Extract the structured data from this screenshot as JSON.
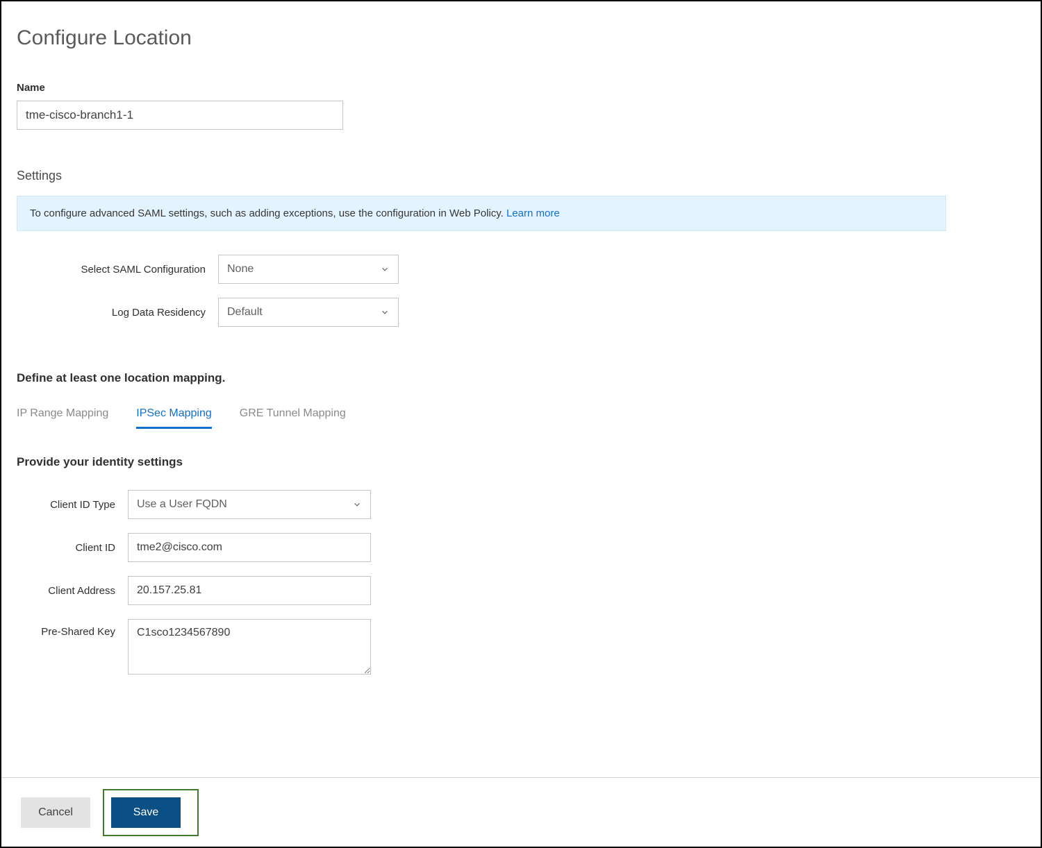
{
  "page": {
    "title": "Configure Location"
  },
  "name": {
    "label": "Name",
    "value": "tme-cisco-branch1-1"
  },
  "settings": {
    "heading": "Settings",
    "banner_text": "To configure advanced SAML settings, such as adding exceptions, use the configuration in Web Policy. ",
    "banner_link": "Learn more",
    "saml_label": "Select SAML Configuration",
    "saml_value": "None",
    "residency_label": "Log Data Residency",
    "residency_value": "Default"
  },
  "mapping": {
    "define_text": "Define at least one location mapping.",
    "tabs": {
      "ip_range": "IP Range Mapping",
      "ipsec": "IPSec Mapping",
      "gre": "GRE Tunnel Mapping"
    }
  },
  "identity": {
    "heading": "Provide your identity settings",
    "client_id_type_label": "Client ID Type",
    "client_id_type_value": "Use a User FQDN",
    "client_id_label": "Client ID",
    "client_id_value": "tme2@cisco.com",
    "client_address_label": "Client Address",
    "client_address_value": "20.157.25.81",
    "psk_label": "Pre-Shared Key",
    "psk_value": "C1sco1234567890"
  },
  "footer": {
    "cancel": "Cancel",
    "save": "Save"
  }
}
